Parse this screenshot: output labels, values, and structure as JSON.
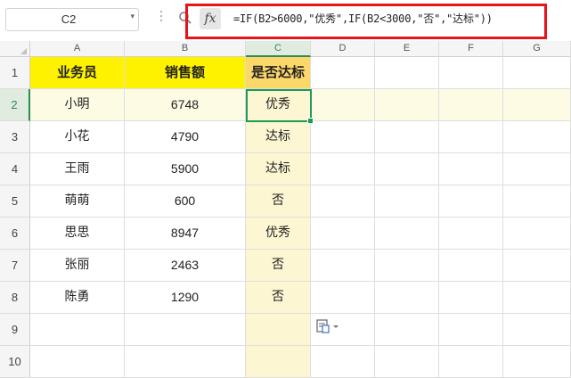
{
  "name_box": {
    "value": "C2"
  },
  "formula_bar": {
    "formula": "=IF(B2>6000,\"优秀\",IF(B2<3000,\"否\",\"达标\"))",
    "fx_label": "fx"
  },
  "columns": [
    "A",
    "B",
    "C",
    "D",
    "E",
    "F",
    "G"
  ],
  "rows": [
    "1",
    "2",
    "3",
    "4",
    "5",
    "6",
    "7",
    "8",
    "9",
    "10"
  ],
  "selected_cell": "C2",
  "table": {
    "headers": [
      "业务员",
      "销售额",
      "是否达标"
    ],
    "rows": [
      [
        "小明",
        "6748",
        "优秀"
      ],
      [
        "小花",
        "4790",
        "达标"
      ],
      [
        "王雨",
        "5900",
        "达标"
      ],
      [
        "萌萌",
        "600",
        "否"
      ],
      [
        "思思",
        "8947",
        "优秀"
      ],
      [
        "张丽",
        "2463",
        "否"
      ],
      [
        "陈勇",
        "1290",
        "否"
      ]
    ]
  },
  "colors": {
    "header_fill": "#fff200",
    "header_fill_c": "#fcd86a",
    "selection_green": "#1f9a55",
    "formula_highlight_border": "#e8141b"
  },
  "icons": {
    "zoom": "magnifier-icon",
    "fx": "fx-icon",
    "paste_options": "paste-options-icon"
  }
}
